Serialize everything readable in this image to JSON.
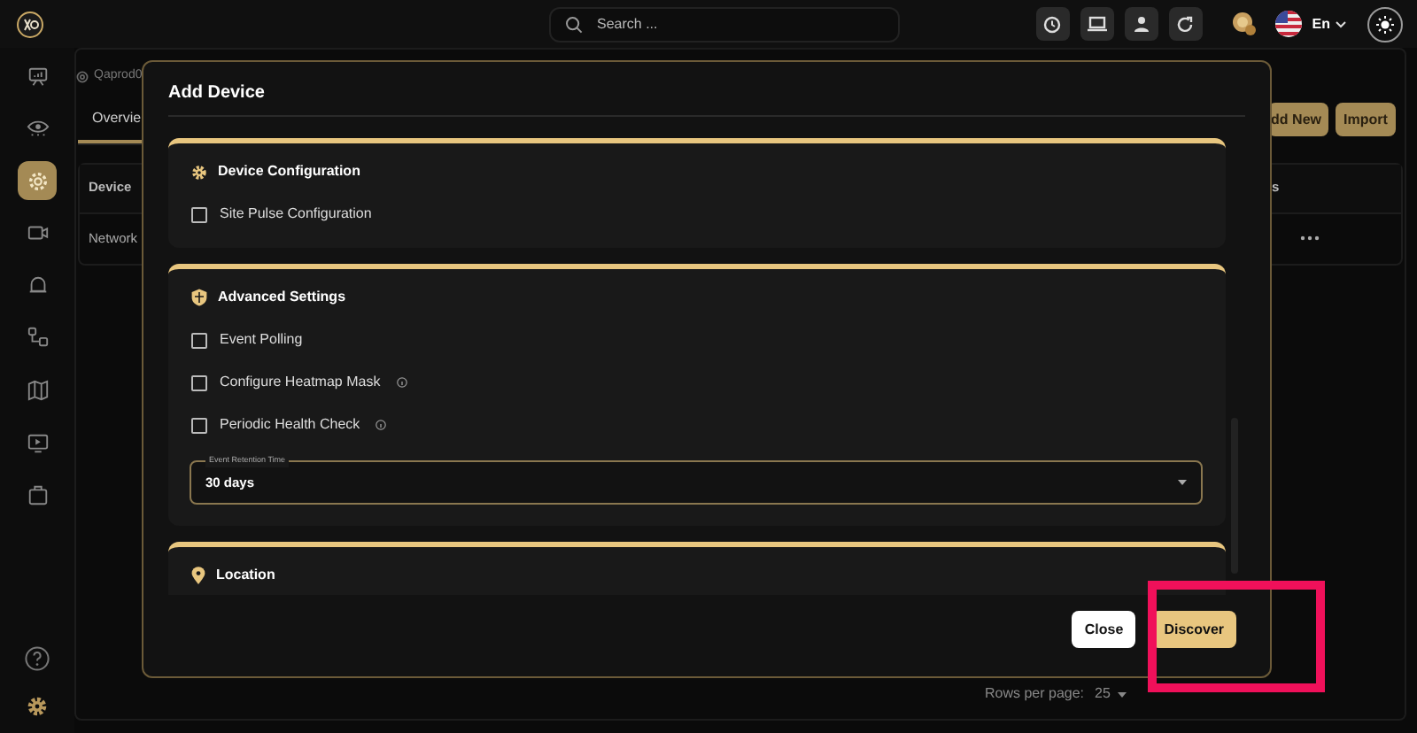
{
  "topbar": {
    "search": {
      "placeholder": "Search ..."
    },
    "language": "En"
  },
  "sidebar": {
    "items": [
      {
        "kind": "monitor",
        "selected": false
      },
      {
        "kind": "eye",
        "selected": false
      },
      {
        "kind": "gear",
        "selected": true
      },
      {
        "kind": "camera",
        "selected": false
      },
      {
        "kind": "bell",
        "selected": false
      },
      {
        "kind": "nodes",
        "selected": false
      },
      {
        "kind": "map",
        "selected": false
      },
      {
        "kind": "play",
        "selected": false
      },
      {
        "kind": "bag",
        "selected": false
      }
    ]
  },
  "page": {
    "breadcrumb": "Qaprod0",
    "tabs": [
      {
        "label": "Overvie",
        "selected": true
      }
    ],
    "buttons": [
      "dd New",
      "Import"
    ],
    "table": {
      "columns": [
        "Device",
        "s"
      ],
      "rows": [
        [
          "Network"
        ]
      ]
    },
    "pagination": {
      "label": "Rows per page:",
      "value": "25"
    }
  },
  "dialog": {
    "title": "Add Device",
    "sections": [
      {
        "title": "Device Configuration",
        "kind": "gear",
        "items": [
          {
            "kind": "checkbox",
            "label": "Site Pulse Configuration",
            "checked": false,
            "info": false
          }
        ]
      },
      {
        "title": "Advanced Settings",
        "kind": "shield",
        "items": [
          {
            "kind": "checkbox",
            "label": "Event Polling",
            "checked": false,
            "info": false
          },
          {
            "kind": "checkbox",
            "label": "Configure Heatmap Mask",
            "checked": false,
            "info": true
          },
          {
            "kind": "checkbox",
            "label": "Periodic Health Check",
            "checked": false,
            "info": true
          },
          {
            "kind": "select",
            "label": "Event Retention Time",
            "value": "30 days"
          }
        ]
      },
      {
        "title": "Location",
        "kind": "pin"
      }
    ],
    "buttons": [
      {
        "label": "Close",
        "kind": "secondary"
      },
      {
        "label": "Discover",
        "kind": "primary"
      }
    ]
  }
}
